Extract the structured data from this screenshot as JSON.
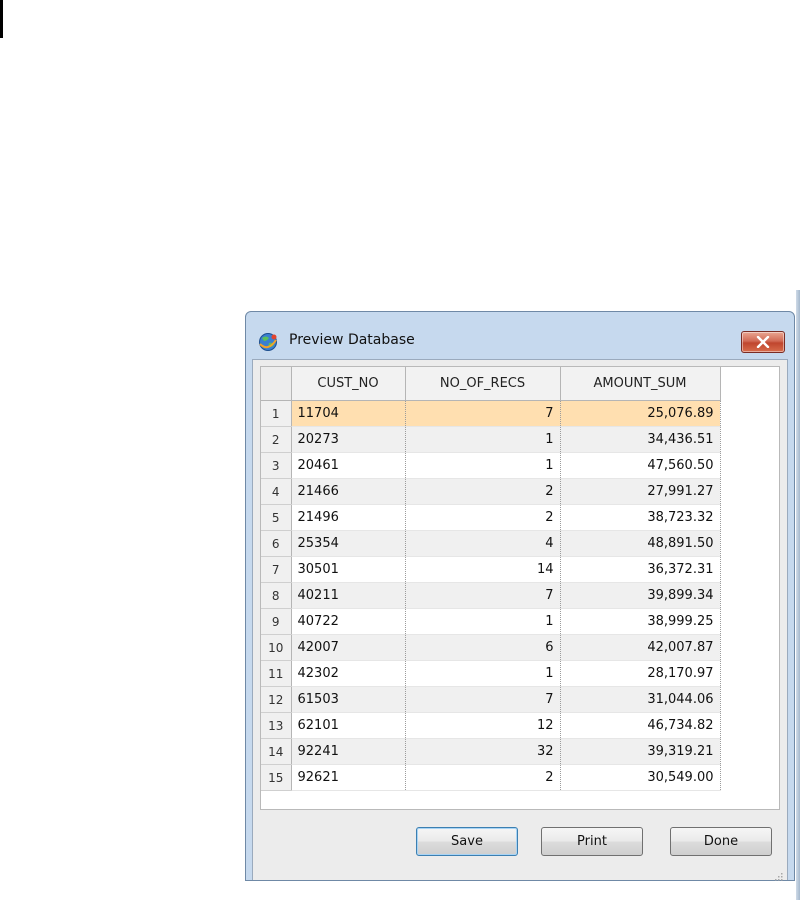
{
  "window": {
    "title": "Preview Database",
    "icon": "app-globe-icon",
    "close_icon": "close-x-icon"
  },
  "grid": {
    "columns": [
      "CUST_NO",
      "NO_OF_RECS",
      "AMOUNT_SUM"
    ],
    "rows": [
      {
        "n": "1",
        "cust_no": "11704",
        "no_of_recs": "7",
        "amount_sum": "25,076.89"
      },
      {
        "n": "2",
        "cust_no": "20273",
        "no_of_recs": "1",
        "amount_sum": "34,436.51"
      },
      {
        "n": "3",
        "cust_no": "20461",
        "no_of_recs": "1",
        "amount_sum": "47,560.50"
      },
      {
        "n": "4",
        "cust_no": "21466",
        "no_of_recs": "2",
        "amount_sum": "27,991.27"
      },
      {
        "n": "5",
        "cust_no": "21496",
        "no_of_recs": "2",
        "amount_sum": "38,723.32"
      },
      {
        "n": "6",
        "cust_no": "25354",
        "no_of_recs": "4",
        "amount_sum": "48,891.50"
      },
      {
        "n": "7",
        "cust_no": "30501",
        "no_of_recs": "14",
        "amount_sum": "36,372.31"
      },
      {
        "n": "8",
        "cust_no": "40211",
        "no_of_recs": "7",
        "amount_sum": "39,899.34"
      },
      {
        "n": "9",
        "cust_no": "40722",
        "no_of_recs": "1",
        "amount_sum": "38,999.25"
      },
      {
        "n": "10",
        "cust_no": "42007",
        "no_of_recs": "6",
        "amount_sum": "42,007.87"
      },
      {
        "n": "11",
        "cust_no": "42302",
        "no_of_recs": "1",
        "amount_sum": "28,170.97"
      },
      {
        "n": "12",
        "cust_no": "61503",
        "no_of_recs": "7",
        "amount_sum": "31,044.06"
      },
      {
        "n": "13",
        "cust_no": "62101",
        "no_of_recs": "12",
        "amount_sum": "46,734.82"
      },
      {
        "n": "14",
        "cust_no": "92241",
        "no_of_recs": "32",
        "amount_sum": "39,319.21"
      },
      {
        "n": "15",
        "cust_no": "92621",
        "no_of_recs": "2",
        "amount_sum": "30,549.00"
      }
    ],
    "selected_row": "1",
    "selected_color": "#ffdfb0"
  },
  "buttons": {
    "save": "Save",
    "print": "Print",
    "done": "Done"
  }
}
